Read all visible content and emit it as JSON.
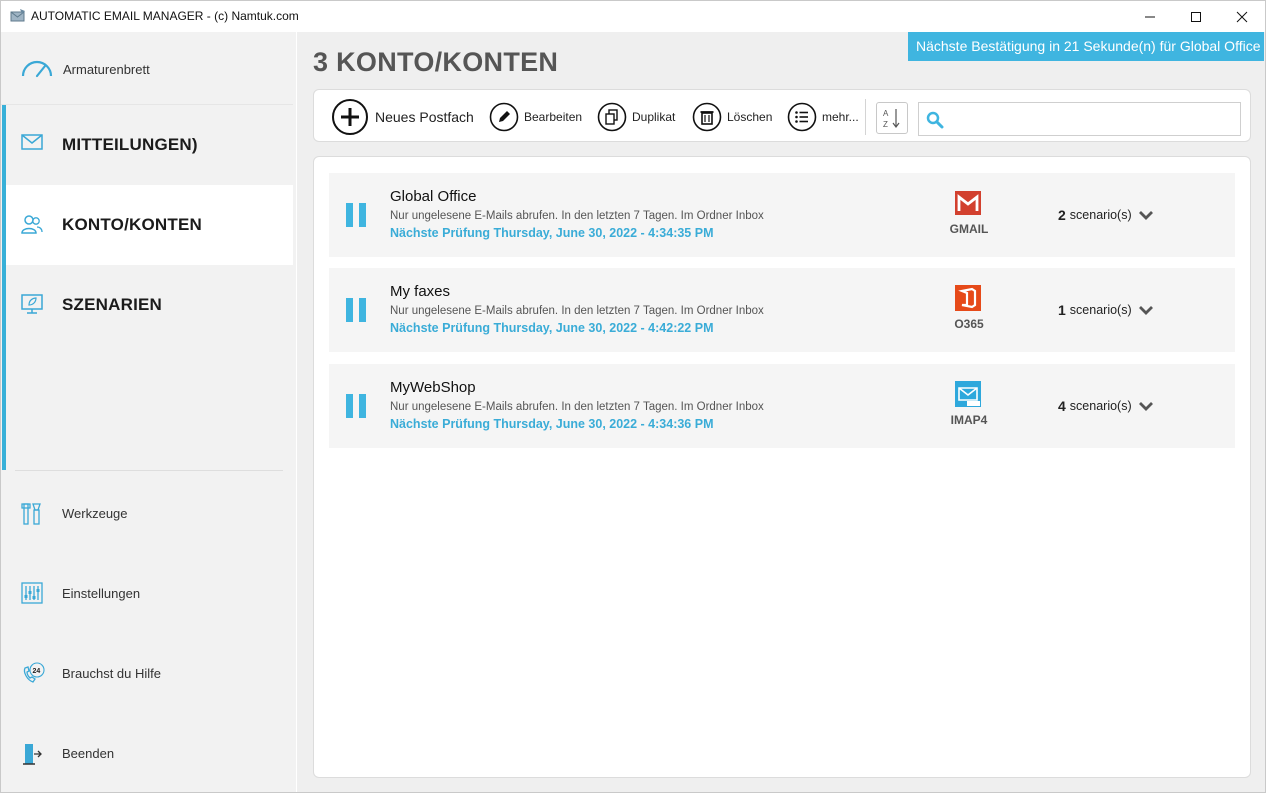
{
  "window": {
    "title": "AUTOMATIC EMAIL MANAGER - (c) Namtuk.com"
  },
  "sidebar": {
    "dashboard_label": "Armaturenbrett",
    "items": [
      {
        "label": "MITTEILUNGEN)",
        "icon": "envelope-icon",
        "active": false
      },
      {
        "label": "KONTO/KONTEN",
        "icon": "users-icon",
        "active": true
      },
      {
        "label": "SZENARIEN",
        "icon": "monitor-leaf-icon",
        "active": false
      }
    ],
    "bottom_items": [
      {
        "label": "Werkzeuge",
        "icon": "tools-icon"
      },
      {
        "label": "Einstellungen",
        "icon": "sliders-icon"
      },
      {
        "label": "Brauchst du Hilfe",
        "icon": "phone-24-icon"
      },
      {
        "label": "Beenden",
        "icon": "exit-door-icon"
      }
    ]
  },
  "main": {
    "heading": "3 KONTO/KONTEN",
    "banner": "Nächste Bestätigung in 21 Sekunde(n) für Global Office",
    "toolbar": {
      "new_label": "Neues Postfach",
      "edit_label": "Bearbeiten",
      "duplicate_label": "Duplikat",
      "delete_label": "Löschen",
      "more_label": "mehr...",
      "search_placeholder": ""
    },
    "accounts": [
      {
        "name": "Global Office",
        "description": "Nur ungelesene E-Mails abrufen. In den letzten 7 Tagen. Im Ordner Inbox",
        "next_check": "Nächste Prüfung Thursday, June 30, 2022 - 4:34:35 PM",
        "provider": "GMAIL",
        "scenario_count": "2",
        "scenario_label": "scenario(s)"
      },
      {
        "name": "My faxes",
        "description": "Nur ungelesene E-Mails abrufen. In den letzten 7 Tagen. Im Ordner Inbox",
        "next_check": "Nächste Prüfung Thursday, June 30, 2022 - 4:42:22 PM",
        "provider": "O365",
        "scenario_count": "1",
        "scenario_label": "scenario(s)"
      },
      {
        "name": "MyWebShop",
        "description": "Nur ungelesene E-Mails abrufen. In den letzten 7 Tagen. Im Ordner Inbox",
        "next_check": "Nächste Prüfung Thursday, June 30, 2022 - 4:34:36 PM",
        "provider": "IMAP4",
        "scenario_count": "4",
        "scenario_label": "scenario(s)"
      }
    ]
  },
  "colors": {
    "accent": "#3fb5e0",
    "next_check": "#3aacd7",
    "gmail": "#d2402e",
    "o365": "#e64a19",
    "imap": "#2ea8dc"
  }
}
